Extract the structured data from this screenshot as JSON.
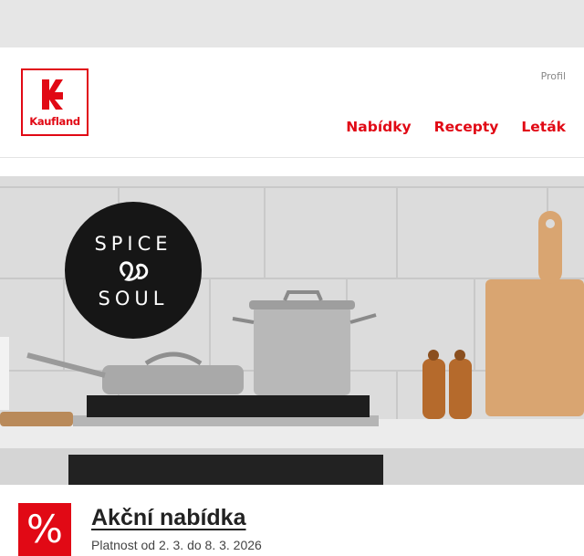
{
  "header": {
    "logo_text": "Kaufland",
    "profile_label": "Profil",
    "nav": [
      {
        "label": "Nabídky"
      },
      {
        "label": "Recepty"
      },
      {
        "label": "Leták"
      }
    ]
  },
  "hero": {
    "badge_line1": "SPICE",
    "badge_line2": "SOUL"
  },
  "offer": {
    "icon_symbol": "%",
    "title": "Akční nabídka",
    "validity": "Platnost od 2. 3. do 8. 3. 2026"
  },
  "colors": {
    "brand_red": "#e10915",
    "topbar": "#e6e6e6",
    "badge": "#161616"
  }
}
